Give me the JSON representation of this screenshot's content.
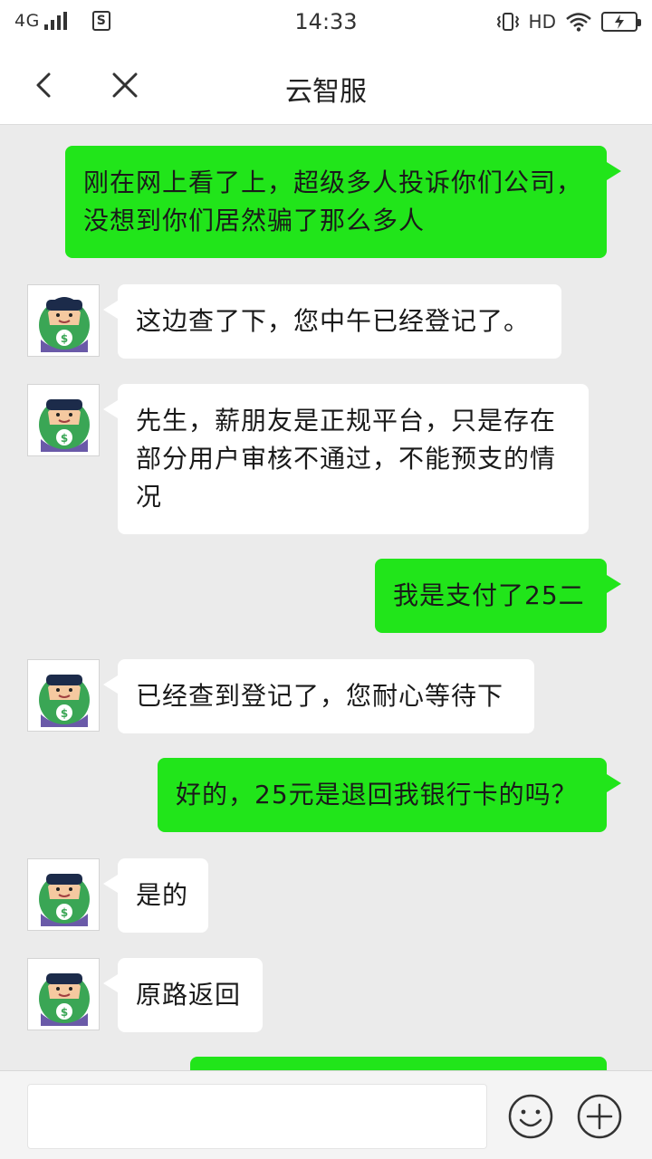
{
  "status_bar": {
    "network": "4G",
    "sim_label": "S",
    "time": "14:33",
    "hd": "HD"
  },
  "nav": {
    "title": "云智服",
    "back_icon": "back-arrow-icon",
    "close_icon": "close-icon"
  },
  "messages": [
    {
      "from": "me",
      "text": "刚在网上看了上，超级多人投诉你们公司，没想到你们居然骗了那么多人"
    },
    {
      "from": "agent",
      "text": "这边查了下，您中午已经登记了。"
    },
    {
      "from": "agent",
      "text": "先生，薪朋友是正规平台，只是存在部分用户审核不通过，不能预支的情况"
    },
    {
      "from": "me",
      "text": "我是支付了25二"
    },
    {
      "from": "agent",
      "text": "已经查到登记了，您耐心等待下"
    },
    {
      "from": "me",
      "text": "好的，25元是退回我银行卡的吗？"
    },
    {
      "from": "agent",
      "text": "是的"
    },
    {
      "from": "agent",
      "text": "原路返回"
    },
    {
      "from": "me",
      "text": ""
    }
  ],
  "input": {
    "value": "",
    "placeholder": ""
  },
  "icons": {
    "emoji": "smiley-icon",
    "plus": "plus-circle-icon",
    "avatar": "agent-avatar-icon"
  },
  "colors": {
    "outgoing_bubble": "#21e51a",
    "incoming_bubble": "#ffffff",
    "chat_background": "#ebebeb"
  }
}
